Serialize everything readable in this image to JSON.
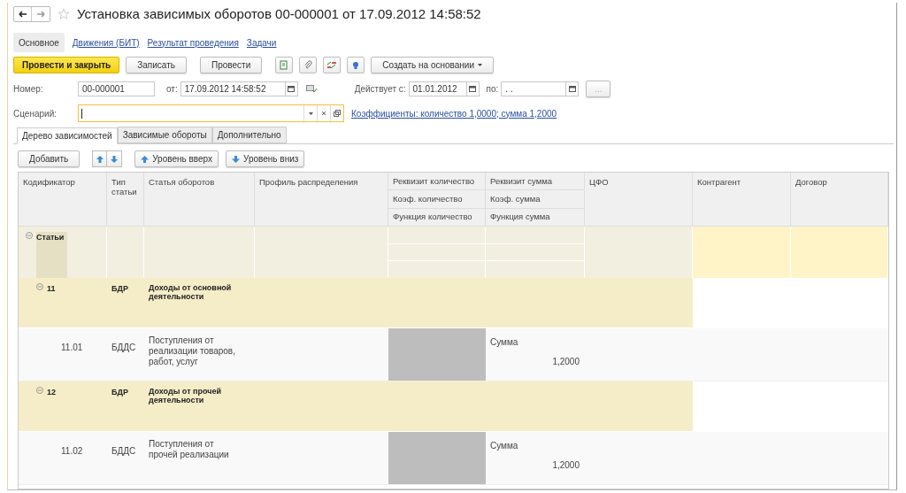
{
  "window": {
    "title": "Установка зависимых оборотов 00-000001 от 17.09.2012 14:58:52"
  },
  "nav_tabs": [
    {
      "label": "Основное",
      "selected": true
    },
    {
      "label": "Движения (БИТ)",
      "selected": false
    },
    {
      "label": "Результат проведения",
      "selected": false
    },
    {
      "label": "Задачи",
      "selected": false
    }
  ],
  "toolbar": {
    "post_close": "Провести и закрыть",
    "save": "Записать",
    "post": "Провести",
    "create_based_on": "Создать на основании"
  },
  "fields": {
    "number_label": "Номер:",
    "number": "00-000001",
    "date_label": "от:",
    "date": "17.09.2012 14:58:52",
    "valid_from_label": "Действует с:",
    "valid_from": "01.01.2012",
    "valid_to_label": "по:",
    "valid_to": ". .",
    "more": "...",
    "scenario_label": "Сценарий:",
    "coefficients_link": "Коэффициенты: количество 1,0000; сумма 1,2000"
  },
  "tabs": [
    {
      "label": "Дерево зависимостей",
      "selected": true
    },
    {
      "label": "Зависимые обороты",
      "selected": false
    },
    {
      "label": "Дополнительно",
      "selected": false
    }
  ],
  "table_toolbar": {
    "add": "Добавить",
    "level_up": "Уровень вверх",
    "level_down": "Уровень вниз"
  },
  "table": {
    "columns": [
      {
        "labels": [
          "Кодификатор"
        ]
      },
      {
        "labels": [
          "Тип статьи"
        ]
      },
      {
        "labels": [
          "Статья оборотов"
        ]
      },
      {
        "labels": [
          "Профиль распределения"
        ]
      },
      {
        "labels": [
          "Реквизит количество",
          "Коэф. количество",
          "Функция количество"
        ]
      },
      {
        "labels": [
          "Реквизит сумма",
          "Коэф. сумма",
          "Функция сумма"
        ]
      },
      {
        "labels": [
          "ЦФО"
        ]
      },
      {
        "labels": [
          "Контрагент"
        ]
      },
      {
        "labels": [
          "Договор"
        ]
      }
    ],
    "rows": [
      {
        "kind": "root",
        "code": "Статьи",
        "expanded": true
      },
      {
        "kind": "group",
        "code": "11",
        "type": "БДР",
        "article": "Доходы от основной деятельности",
        "expanded": true
      },
      {
        "kind": "item",
        "code": "11.01",
        "type": "БДДС",
        "article": "Поступления от реализации товаров, работ, услуг",
        "sum_attribute": "Сумма",
        "sum_coef": "1,2000"
      },
      {
        "kind": "group",
        "code": "12",
        "type": "БДР",
        "article": "Доходы от прочей деятельности",
        "expanded": true
      },
      {
        "kind": "item",
        "code": "11.02",
        "type": "БДДС",
        "article": "Поступления от прочей реализации",
        "sum_attribute": "Сумма",
        "sum_coef": "1,2000"
      }
    ]
  }
}
